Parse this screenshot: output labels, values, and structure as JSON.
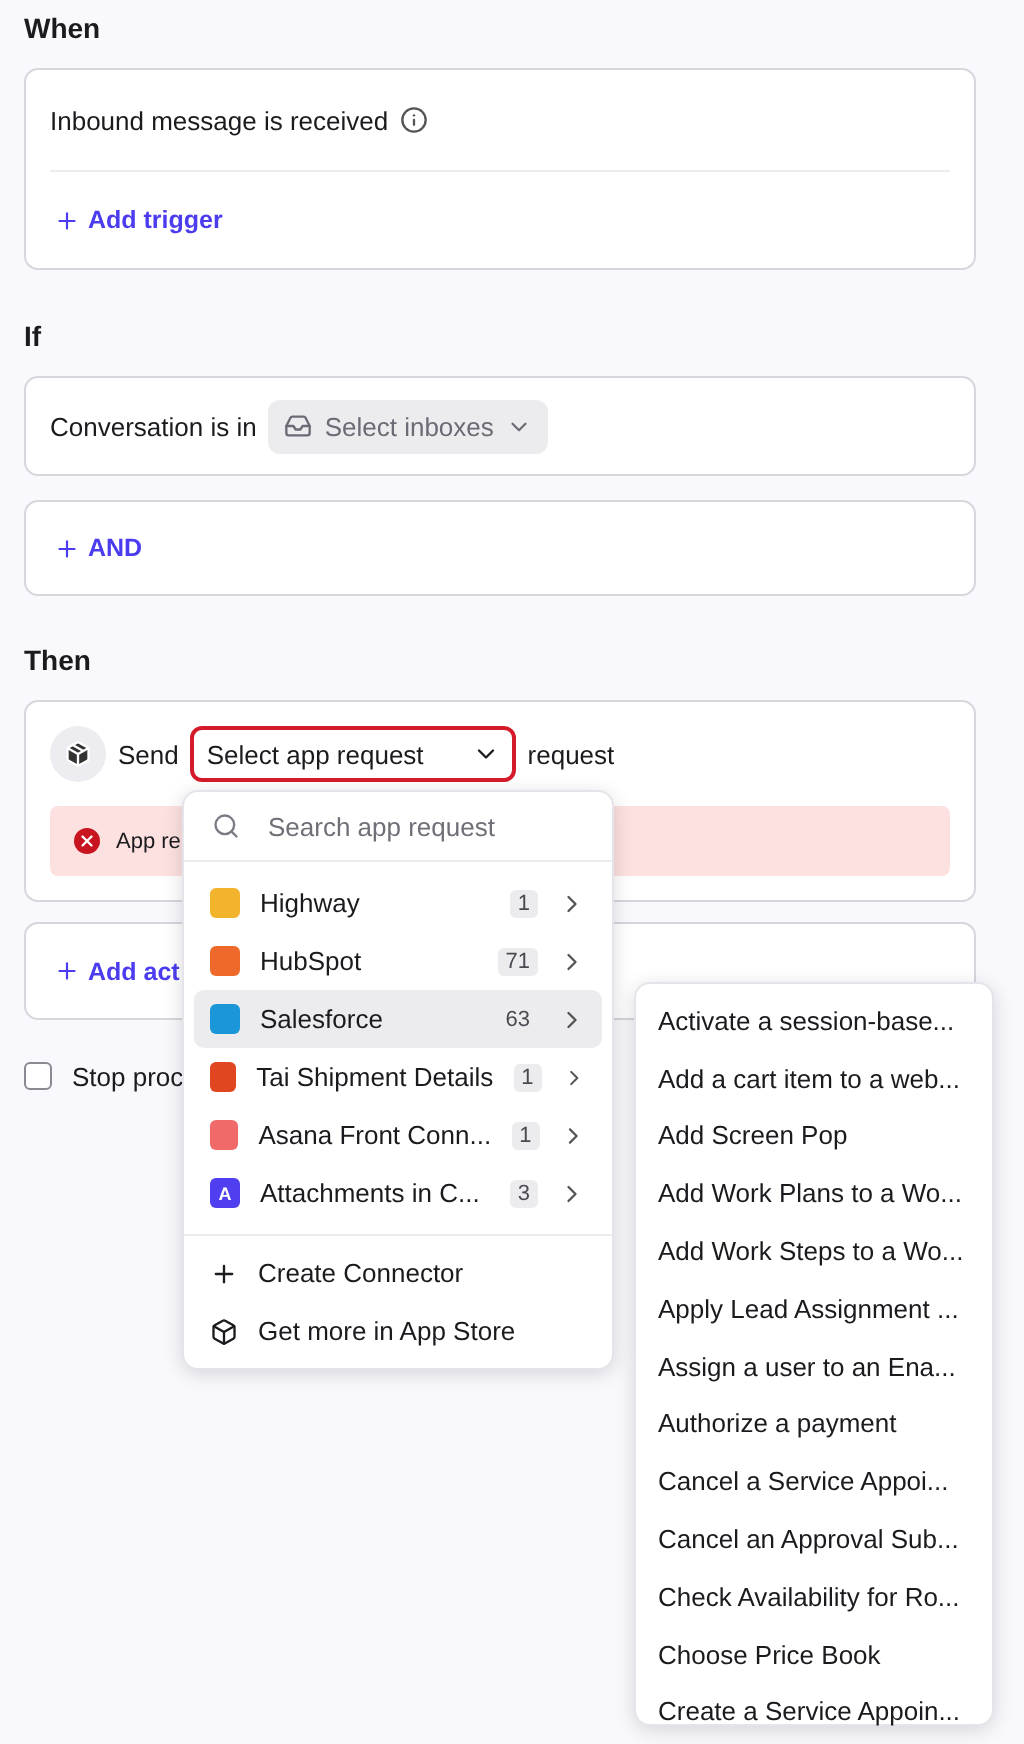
{
  "when": {
    "heading": "When",
    "trigger": "Inbound message is received",
    "add_trigger": "Add trigger"
  },
  "if": {
    "heading": "If",
    "condition_label": "Conversation is in",
    "inbox_select": {
      "placeholder": "Select inboxes"
    },
    "and_button": "AND"
  },
  "then": {
    "heading": "Then",
    "send_label": "Send",
    "app_select": {
      "placeholder": "Select app request",
      "invalid": true
    },
    "suffix": "request",
    "error": "App re",
    "add_action": "Add act"
  },
  "stop": {
    "label": "Stop proc",
    "checked": false
  },
  "dropdown": {
    "search": {
      "placeholder": "Search app request"
    },
    "apps": [
      {
        "name": "Highway",
        "count": "1",
        "color": "#f2b42c",
        "selected": false
      },
      {
        "name": "HubSpot",
        "count": "71",
        "color": "#ee6a2c",
        "selected": false
      },
      {
        "name": "Salesforce",
        "count": "63",
        "color": "#1b96d9",
        "selected": true
      },
      {
        "name": "Tai Shipment Details",
        "count": "1",
        "color": "#e0461f",
        "selected": false
      },
      {
        "name": "Asana Front Conn...",
        "count": "1",
        "color": "#f06a6a",
        "selected": false
      },
      {
        "name": "Attachments in C...",
        "count": "3",
        "color": "#4f3ff0",
        "selected": false,
        "logo_text": "A"
      }
    ],
    "footer": [
      {
        "kind": "create",
        "label": "Create Connector"
      },
      {
        "kind": "store",
        "label": "Get more in App Store"
      }
    ]
  },
  "submenu": [
    "Activate a session-base...",
    "Add a cart item to a web...",
    "Add Screen Pop",
    "Add Work Plans to a Wo...",
    "Add Work Steps to a Wo...",
    "Apply Lead Assignment ...",
    "Assign a user to an Ena...",
    "Authorize a payment",
    "Cancel a Service Appoi...",
    "Cancel an Approval Sub...",
    "Check Availability for Ro...",
    "Choose Price Book",
    "Create a Service Appoin..."
  ]
}
